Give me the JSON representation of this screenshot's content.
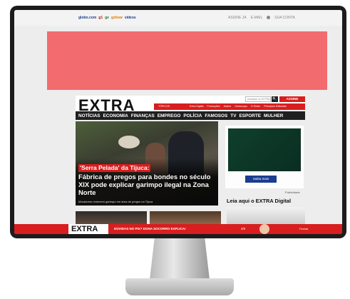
{
  "topbar": {
    "globo": "globo.com",
    "g1": "g1",
    "ge": "ge",
    "gshow": "gshow",
    "videos": "videos",
    "right_1": "ASSINE JA",
    "right_2": "E-MAIL",
    "user": "SUA CONTA"
  },
  "header": {
    "logo": "EXTRA",
    "topics_label": "TÓPICOS",
    "links": [
      "Extra Digital",
      "Promoções",
      "Assine",
      "Horóscopo",
      "O Globo",
      "Princípios Editoriais"
    ],
    "search_placeholder": "pesquise no EXTRA",
    "search_button": "🔍",
    "subscribe": "ASSINE"
  },
  "nav": {
    "items": [
      "NOTÍCIAS",
      "ECONOMIA",
      "FINANÇAS",
      "EMPREGO",
      "POLÍCIA",
      "FAMOSOS",
      "TV",
      "ESPORTE",
      "MULHER"
    ]
  },
  "main_story": {
    "kicker": "'Serra Pelada' da Tijuca:",
    "headline": "Fábrica de pregos para bondes no século XIX pode explicar garimpo ilegal na Zona Norte",
    "caption": "Moradores remexem garimpo em área de pregos na Tijuca"
  },
  "sidebar": {
    "ad_button": "Saiba mais",
    "publicidade": "Publicidade",
    "digital_title": "Leia aqui o EXTRA Digital"
  },
  "footer": {
    "logo": "EXTRA",
    "text": "DÚVIDAS NO PIX? DONA SOCORRO EXPLICA!",
    "number": "2/5",
    "right": "Fechar"
  },
  "colors": {
    "accent": "#d81e1e",
    "ad": "#f26b6f",
    "nav": "#1f1f1f"
  }
}
